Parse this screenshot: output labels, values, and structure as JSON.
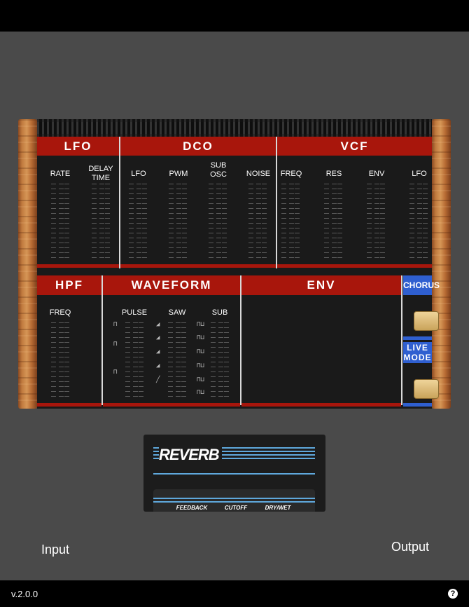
{
  "footer": {
    "version": "v.2.0.0",
    "help_label": "?"
  },
  "sections": {
    "lfo": {
      "title": "LFO",
      "controls": [
        "RATE",
        "DELAY\nTIME"
      ]
    },
    "dco": {
      "title": "DCO",
      "controls": [
        "LFO",
        "PWM",
        "SUB\nOSC",
        "NOISE"
      ]
    },
    "vcf": {
      "title": "VCF",
      "controls": [
        "FREQ",
        "RES",
        "ENV",
        "LFO"
      ]
    },
    "hpf": {
      "title": "HPF",
      "controls": [
        "FREQ"
      ]
    },
    "waveform": {
      "title": "WAVEFORM",
      "controls": [
        "PULSE",
        "SAW",
        "SUB"
      ]
    },
    "env": {
      "title": "ENV"
    },
    "chorus": {
      "title": "CHORUS"
    },
    "live_mode": {
      "title": "LIVE\nMODE"
    }
  },
  "reverb": {
    "title": "REVERB",
    "controls": [
      "FEEDBACK",
      "CUTOFF",
      "DRY/WET"
    ]
  },
  "io": {
    "input": "Input",
    "output": "Output"
  },
  "colors": {
    "section_red": "#a8160c",
    "accent_blue": "#2f5fd0",
    "reverb_line": "#5fa8dc"
  }
}
